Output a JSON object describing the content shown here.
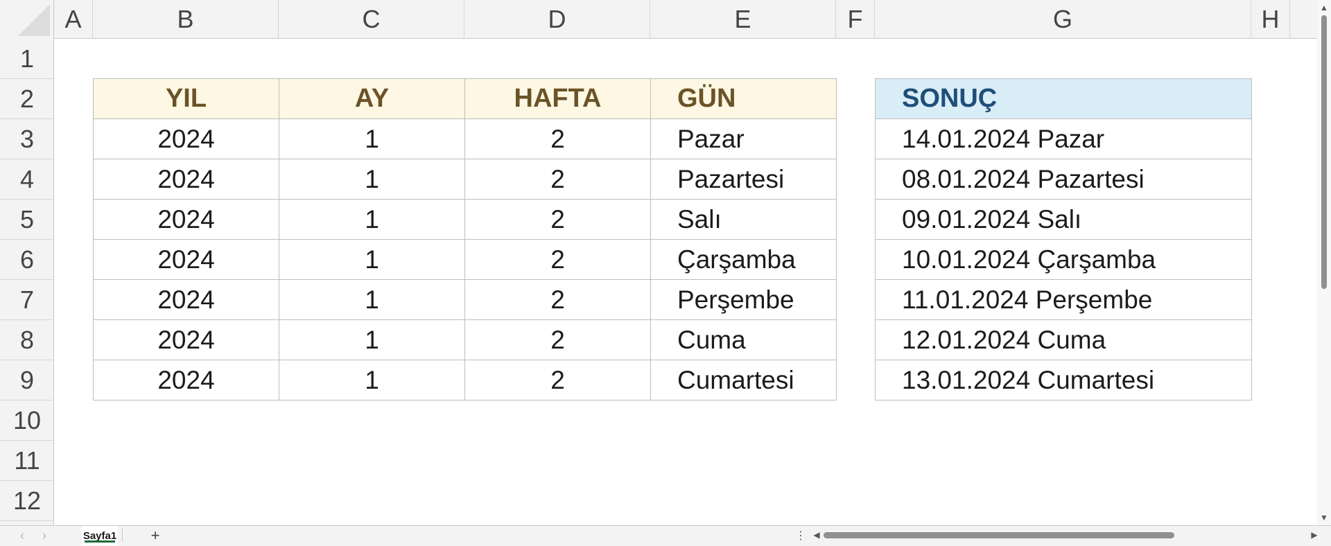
{
  "columns": [
    "A",
    "B",
    "C",
    "D",
    "E",
    "F",
    "G",
    "H"
  ],
  "rows": [
    "1",
    "2",
    "3",
    "4",
    "5",
    "6",
    "7",
    "8",
    "9",
    "10",
    "11",
    "12"
  ],
  "table1": {
    "headers": [
      "YIL",
      "AY",
      "HAFTA",
      "GÜN"
    ],
    "rows": [
      [
        "2024",
        "1",
        "2",
        "Pazar"
      ],
      [
        "2024",
        "1",
        "2",
        "Pazartesi"
      ],
      [
        "2024",
        "1",
        "2",
        "Salı"
      ],
      [
        "2024",
        "1",
        "2",
        "Çarşamba"
      ],
      [
        "2024",
        "1",
        "2",
        "Perşembe"
      ],
      [
        "2024",
        "1",
        "2",
        "Cuma"
      ],
      [
        "2024",
        "1",
        "2",
        "Cumartesi"
      ]
    ]
  },
  "table2": {
    "header": "SONUÇ",
    "rows": [
      "14.01.2024 Pazar",
      "08.01.2024 Pazartesi",
      "09.01.2024 Salı",
      "10.01.2024 Çarşamba",
      "11.01.2024 Perşembe",
      "12.01.2024 Cuma",
      "13.01.2024 Cumartesi"
    ]
  },
  "sheets": {
    "active": "Sayfa1",
    "add_label": "+"
  },
  "colors": {
    "header_yellow_bg": "#fdf7e3",
    "header_yellow_text": "#6b5328",
    "header_blue_bg": "#d9edf7",
    "header_blue_text": "#1f4e79",
    "sheet_tab_accent": "#1e6b3c"
  },
  "icons": {
    "prev_sheet": "chevron-left-icon",
    "next_sheet": "chevron-right-icon",
    "add_sheet": "plus-icon",
    "more": "vertical-dots-icon"
  }
}
